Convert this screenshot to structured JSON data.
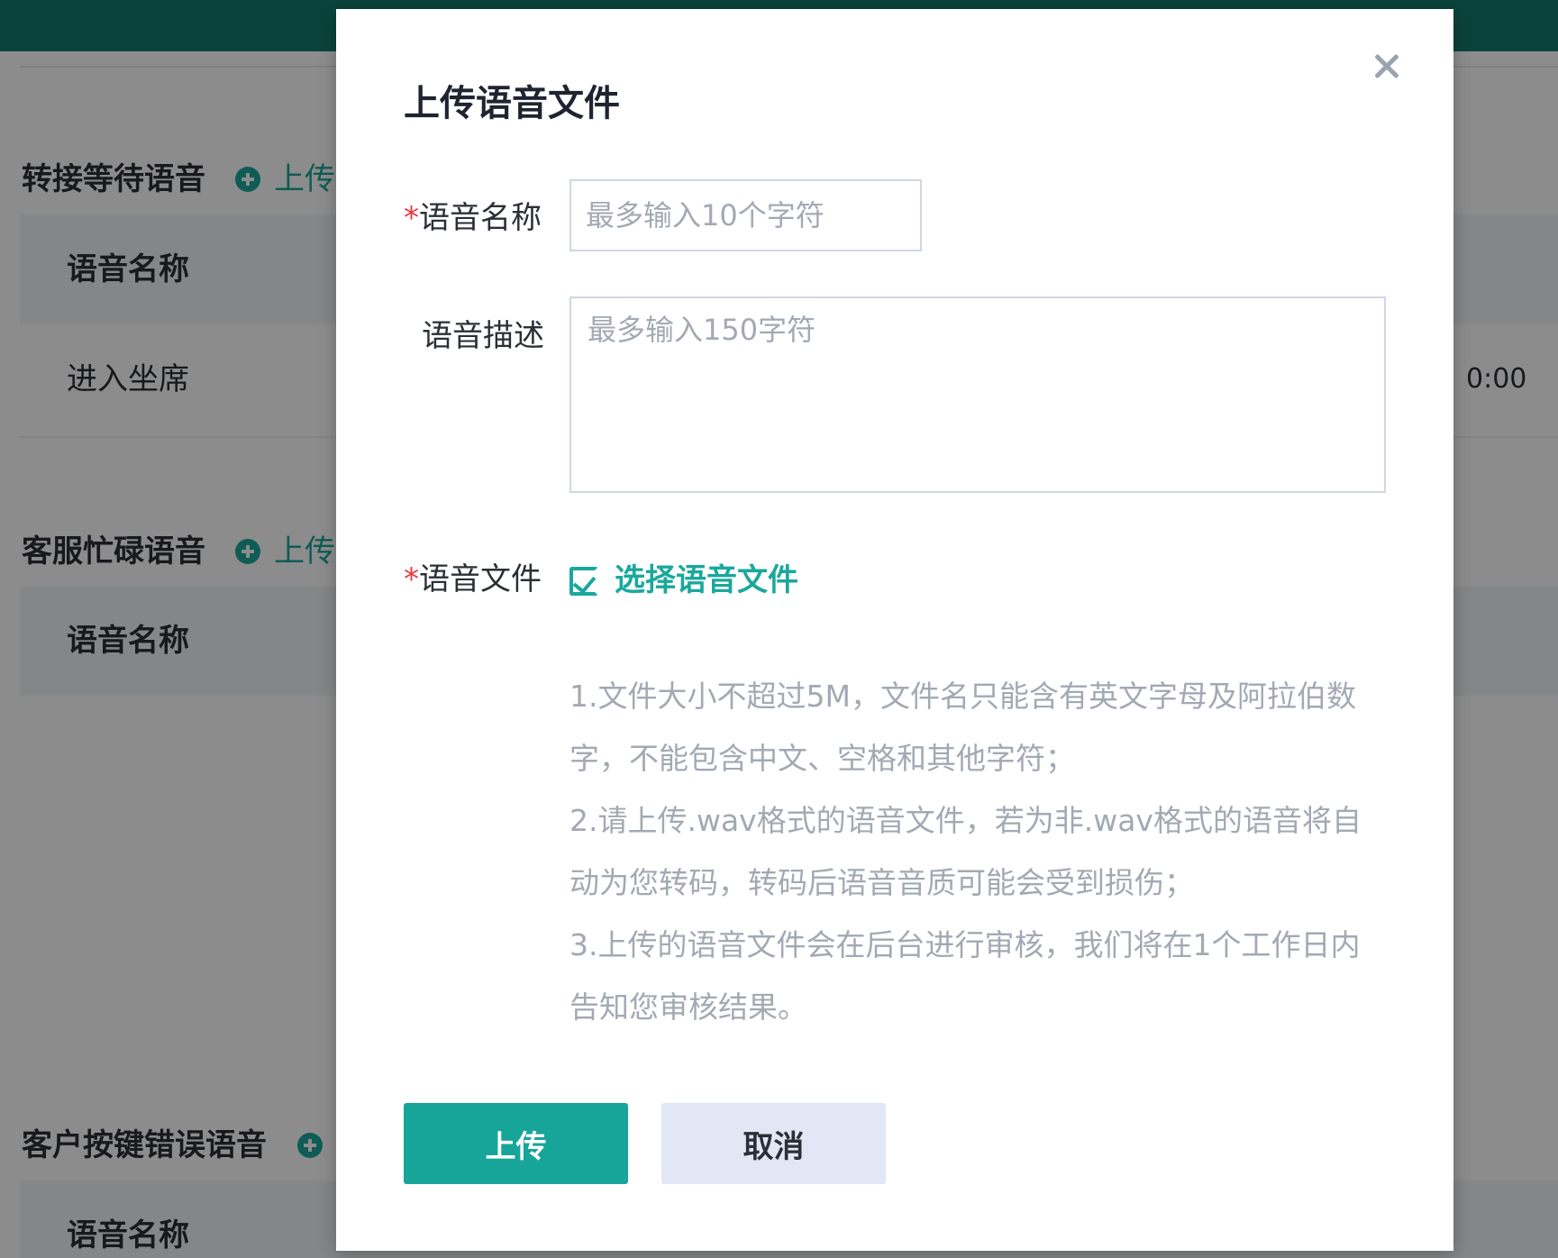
{
  "background": {
    "colors": {
      "header": "#137a6c",
      "accent": "#1aa89c"
    },
    "sections": [
      {
        "title": "转接等待语音",
        "upload_label": "上传",
        "table_header": "语音名称",
        "rows": [
          {
            "name": "进入坐席",
            "duration": "0:00"
          }
        ]
      },
      {
        "title": "客服忙碌语音",
        "upload_label": "上传",
        "table_header": "语音名称"
      },
      {
        "title": "客户按键错误语音",
        "table_header": "语音名称"
      }
    ]
  },
  "modal": {
    "title": "上传语音文件",
    "close_icon": "close-icon",
    "required_mark": "*",
    "name_field": {
      "label": "语音名称",
      "placeholder": "最多输入10个字符",
      "value": ""
    },
    "desc_field": {
      "label": "语音描述",
      "placeholder": "最多输入150字符",
      "value": ""
    },
    "file_field": {
      "label": "语音文件",
      "select_label": "选择语音文件",
      "icon": "checkbox-icon"
    },
    "notes": [
      "1.文件大小不超过5M，文件名只能含有英文字母及阿拉伯数字，不能包含中文、空格和其他字符；",
      "2.请上传.wav格式的语音文件，若为非.wav格式的语音将自动为您转码，转码后语音音质可能会受到损伤；",
      "3.上传的语音文件会在后台进行审核，我们将在1个工作日内告知您审核结果。"
    ],
    "buttons": {
      "submit": "上传",
      "cancel": "取消"
    },
    "colors": {
      "primary": "#17a59a",
      "secondary": "#e1e7f4",
      "required": "#e6393f"
    }
  }
}
